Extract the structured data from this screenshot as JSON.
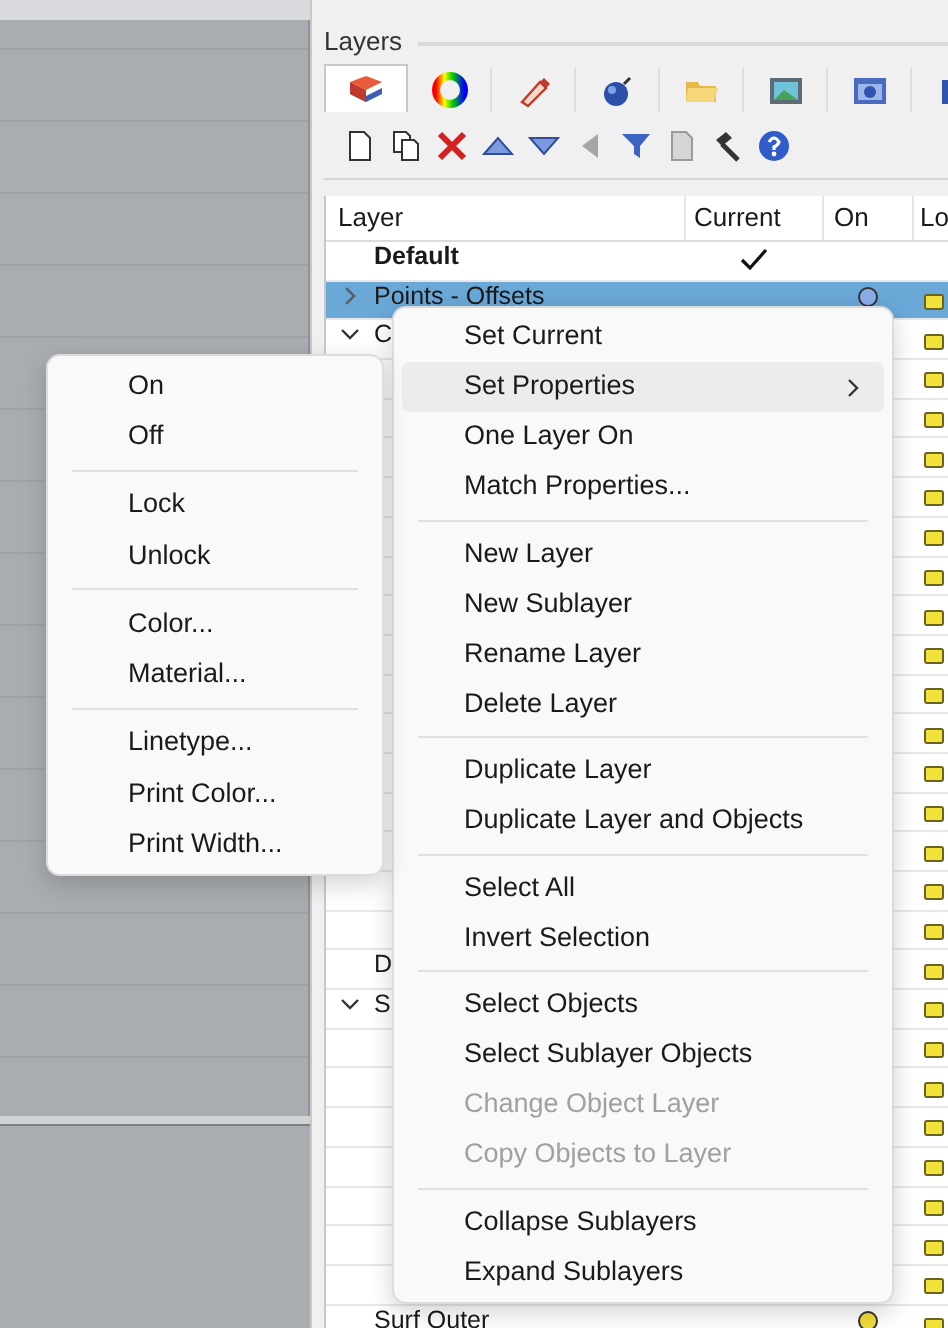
{
  "panel": {
    "title": "Layers"
  },
  "tabs": [
    {
      "selected": true
    },
    {
      "selected": false
    },
    {
      "selected": false
    },
    {
      "selected": false
    },
    {
      "selected": false
    },
    {
      "selected": false
    },
    {
      "selected": false
    },
    {
      "selected": false
    }
  ],
  "table": {
    "columns": [
      "Layer",
      "Current",
      "On",
      "Lo"
    ],
    "rows": [
      {
        "name": "Default",
        "bold": true,
        "current": true,
        "selected": false
      },
      {
        "name": "Points - Offsets",
        "bold": false,
        "current": false,
        "expanded": false,
        "selected": true,
        "on": true
      },
      {
        "name": "C",
        "bold": false,
        "expanded": true,
        "selected": false
      },
      {
        "selected": false
      },
      {
        "selected": false
      },
      {
        "selected": false
      },
      {
        "selected": false
      },
      {
        "selected": false
      },
      {
        "selected": false
      },
      {
        "selected": false
      },
      {
        "selected": false
      },
      {
        "selected": false
      },
      {
        "selected": false
      },
      {
        "selected": false
      },
      {
        "selected": false
      },
      {
        "selected": false
      },
      {
        "selected": false
      },
      {
        "selected": false
      },
      {
        "name": "D",
        "bold": false,
        "selected": false
      },
      {
        "name": "S",
        "bold": false,
        "expanded": true,
        "selected": false
      },
      {
        "selected": false
      },
      {
        "selected": false
      },
      {
        "selected": false
      },
      {
        "selected": false
      },
      {
        "selected": false
      },
      {
        "selected": false
      },
      {
        "selected": false
      },
      {
        "name": "Surf Outer",
        "bold": false,
        "current": false,
        "selected": false,
        "on": true
      }
    ]
  },
  "context_menu": {
    "items": [
      {
        "kind": "item",
        "label": "Set Current",
        "disabled": false,
        "highlighted": false,
        "submenu": false
      },
      {
        "kind": "item",
        "label": "Set Properties",
        "disabled": false,
        "highlighted": true,
        "submenu": true
      },
      {
        "kind": "item",
        "label": "One Layer On",
        "disabled": false,
        "highlighted": false,
        "submenu": false
      },
      {
        "kind": "item",
        "label": "Match Properties...",
        "disabled": false,
        "highlighted": false,
        "submenu": false
      },
      {
        "kind": "separator"
      },
      {
        "kind": "item",
        "label": "New Layer",
        "disabled": false,
        "highlighted": false,
        "submenu": false
      },
      {
        "kind": "item",
        "label": "New Sublayer",
        "disabled": false,
        "highlighted": false,
        "submenu": false
      },
      {
        "kind": "item",
        "label": "Rename Layer",
        "disabled": false,
        "highlighted": false,
        "submenu": false
      },
      {
        "kind": "item",
        "label": "Delete Layer",
        "disabled": false,
        "highlighted": false,
        "submenu": false
      },
      {
        "kind": "separator"
      },
      {
        "kind": "item",
        "label": "Duplicate Layer",
        "disabled": false,
        "highlighted": false,
        "submenu": false
      },
      {
        "kind": "item",
        "label": "Duplicate Layer and Objects",
        "disabled": false,
        "highlighted": false,
        "submenu": false
      },
      {
        "kind": "separator"
      },
      {
        "kind": "item",
        "label": "Select All",
        "disabled": false,
        "highlighted": false,
        "submenu": false
      },
      {
        "kind": "item",
        "label": "Invert Selection",
        "disabled": false,
        "highlighted": false,
        "submenu": false
      },
      {
        "kind": "separator"
      },
      {
        "kind": "item",
        "label": "Select Objects",
        "disabled": false,
        "highlighted": false,
        "submenu": false
      },
      {
        "kind": "item",
        "label": "Select Sublayer Objects",
        "disabled": false,
        "highlighted": false,
        "submenu": false
      },
      {
        "kind": "item",
        "label": "Change Object Layer",
        "disabled": true,
        "highlighted": false,
        "submenu": false
      },
      {
        "kind": "item",
        "label": "Copy Objects to Layer",
        "disabled": true,
        "highlighted": false,
        "submenu": false
      },
      {
        "kind": "separator"
      },
      {
        "kind": "item",
        "label": "Collapse Sublayers",
        "disabled": false,
        "highlighted": false,
        "submenu": false
      },
      {
        "kind": "item",
        "label": "Expand Sublayers",
        "disabled": false,
        "highlighted": false,
        "submenu": false
      }
    ]
  },
  "submenu": {
    "items": [
      {
        "kind": "item",
        "label": "On"
      },
      {
        "kind": "item",
        "label": "Off"
      },
      {
        "kind": "separator"
      },
      {
        "kind": "item",
        "label": "Lock"
      },
      {
        "kind": "item",
        "label": "Unlock"
      },
      {
        "kind": "separator"
      },
      {
        "kind": "item",
        "label": "Color..."
      },
      {
        "kind": "item",
        "label": "Material..."
      },
      {
        "kind": "separator"
      },
      {
        "kind": "item",
        "label": "Linetype..."
      },
      {
        "kind": "item",
        "label": "Print Color..."
      },
      {
        "kind": "item",
        "label": "Print Width..."
      }
    ]
  }
}
